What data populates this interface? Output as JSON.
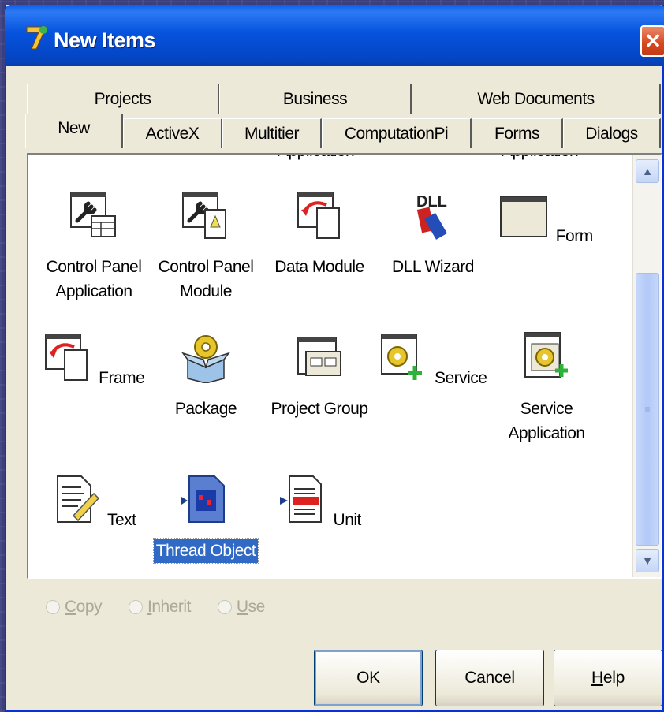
{
  "window": {
    "title": "New Items"
  },
  "tabs_row1": [
    "Projects",
    "Business",
    "Web Documents"
  ],
  "tabs_row2": [
    "New",
    "ActiveX",
    "Multitier",
    "ComputationPi",
    "Forms",
    "Dialogs"
  ],
  "active_tab": "New",
  "partial_items": [
    "Application",
    "Application"
  ],
  "items": [
    {
      "label": "Control Panel\nApplication",
      "icon": "control-panel-application-icon"
    },
    {
      "label": "Control Panel\nModule",
      "icon": "control-panel-module-icon"
    },
    {
      "label": "Data Module",
      "icon": "data-module-icon"
    },
    {
      "label": "DLL Wizard",
      "icon": "dll-wizard-icon"
    },
    {
      "label": "Form",
      "icon": "form-icon"
    },
    {
      "label": "Frame",
      "icon": "frame-icon"
    },
    {
      "label": "Package",
      "icon": "package-icon"
    },
    {
      "label": "Project Group",
      "icon": "project-group-icon"
    },
    {
      "label": "Service",
      "icon": "service-icon"
    },
    {
      "label": "Service\nApplication",
      "icon": "service-application-icon"
    },
    {
      "label": "Text",
      "icon": "text-icon"
    },
    {
      "label": "Thread Object",
      "icon": "thread-object-icon",
      "selected": true
    },
    {
      "label": "Unit",
      "icon": "unit-icon"
    }
  ],
  "radio_options": [
    {
      "label": "Copy",
      "underline": "C",
      "rest": "opy"
    },
    {
      "label": "Inherit",
      "underline": "I",
      "rest": "nherit"
    },
    {
      "label": "Use",
      "underline": "U",
      "rest": "se"
    }
  ],
  "buttons": {
    "ok": "OK",
    "cancel": "Cancel",
    "help": {
      "label": "Help",
      "underline": "H",
      "rest": "elp"
    }
  },
  "colors": {
    "selection": "#316ac5",
    "titlebar": "#0653dd",
    "close": "#d6461e"
  }
}
